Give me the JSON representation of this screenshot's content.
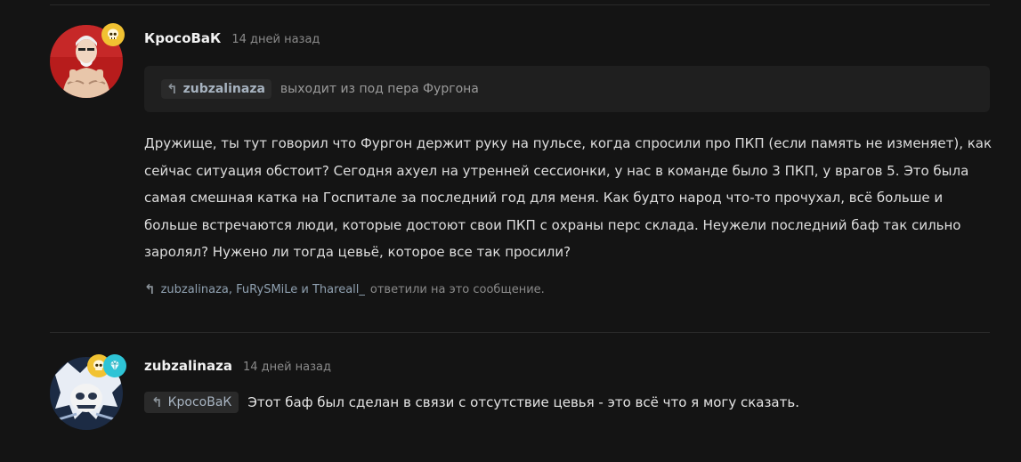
{
  "post1": {
    "author": "КросоВаК",
    "time": "14 дней назад",
    "badge_icon": "skull-icon",
    "quote": {
      "mention": "zubzalinaza",
      "text": "выходит из под пера Фургона"
    },
    "body": "Дружище, ты тут говорил что Фургон держит руку на пульсе, когда спросили про ПКП (если память не изменяет), как сейчас ситуация обстоит? Сегодня ахуел на утренней сессионки, у нас в команде было 3 ПКП, у врагов 5. Это была самая смешная катка на Госпитале за последний год для меня. Как будто народ что-то прочухал, всё больше и больше встречаются люди, которые достоют свои ПКП с охраны перс склада. Неужели последний баф так сильно заролял? Нужено ли тогда цевьё, которое все так просили?",
    "replies": {
      "names": "zubzalinaza, FuRySMiLe и Thareall_",
      "suffix": "ответили на это сообщение."
    }
  },
  "post2": {
    "author": "zubzalinaza",
    "time": "14 дней назад",
    "mention": "КросоВаК",
    "text": "Этот баф был сделан в связи с отсутствие цевья - это всё что я могу сказать."
  },
  "colors": {
    "background": "#141414",
    "gold_badge": "#f1c232",
    "diamond_badge": "#2ec4d6"
  }
}
